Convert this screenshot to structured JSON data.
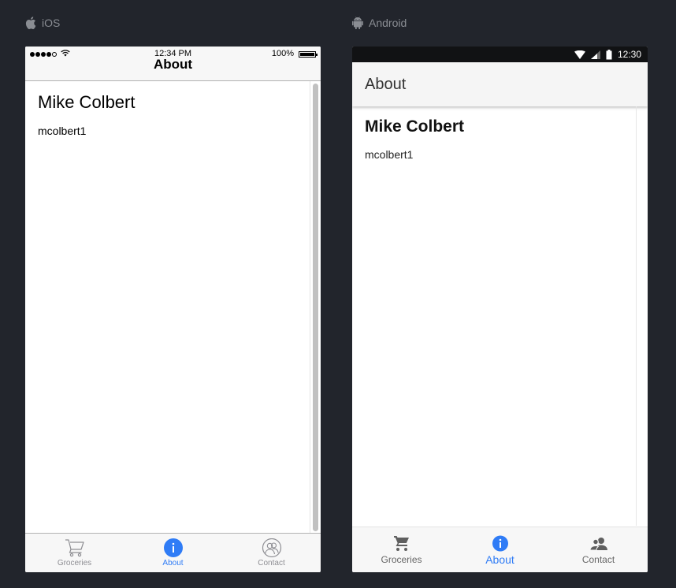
{
  "platforms": {
    "ios_label": "iOS",
    "android_label": "Android"
  },
  "ios": {
    "status": {
      "time": "12:34 PM",
      "battery": "100%"
    },
    "title": "About",
    "profile": {
      "name": "Mike Colbert",
      "username": "mcolbert1"
    },
    "tabs": [
      {
        "label": "Groceries",
        "icon": "cart-icon",
        "active": false
      },
      {
        "label": "About",
        "icon": "info-icon",
        "active": true
      },
      {
        "label": "Contact",
        "icon": "contact-icon",
        "active": false
      }
    ]
  },
  "android": {
    "status": {
      "time": "12:30"
    },
    "title": "About",
    "profile": {
      "name": "Mike Colbert",
      "username": "mcolbert1"
    },
    "tabs": [
      {
        "label": "Groceries",
        "icon": "cart-icon",
        "active": false
      },
      {
        "label": "About",
        "icon": "info-icon",
        "active": true
      },
      {
        "label": "Contact",
        "icon": "contact-icon",
        "active": false
      }
    ]
  },
  "colors": {
    "accent": "#2f7cf6",
    "background": "#22252c"
  }
}
